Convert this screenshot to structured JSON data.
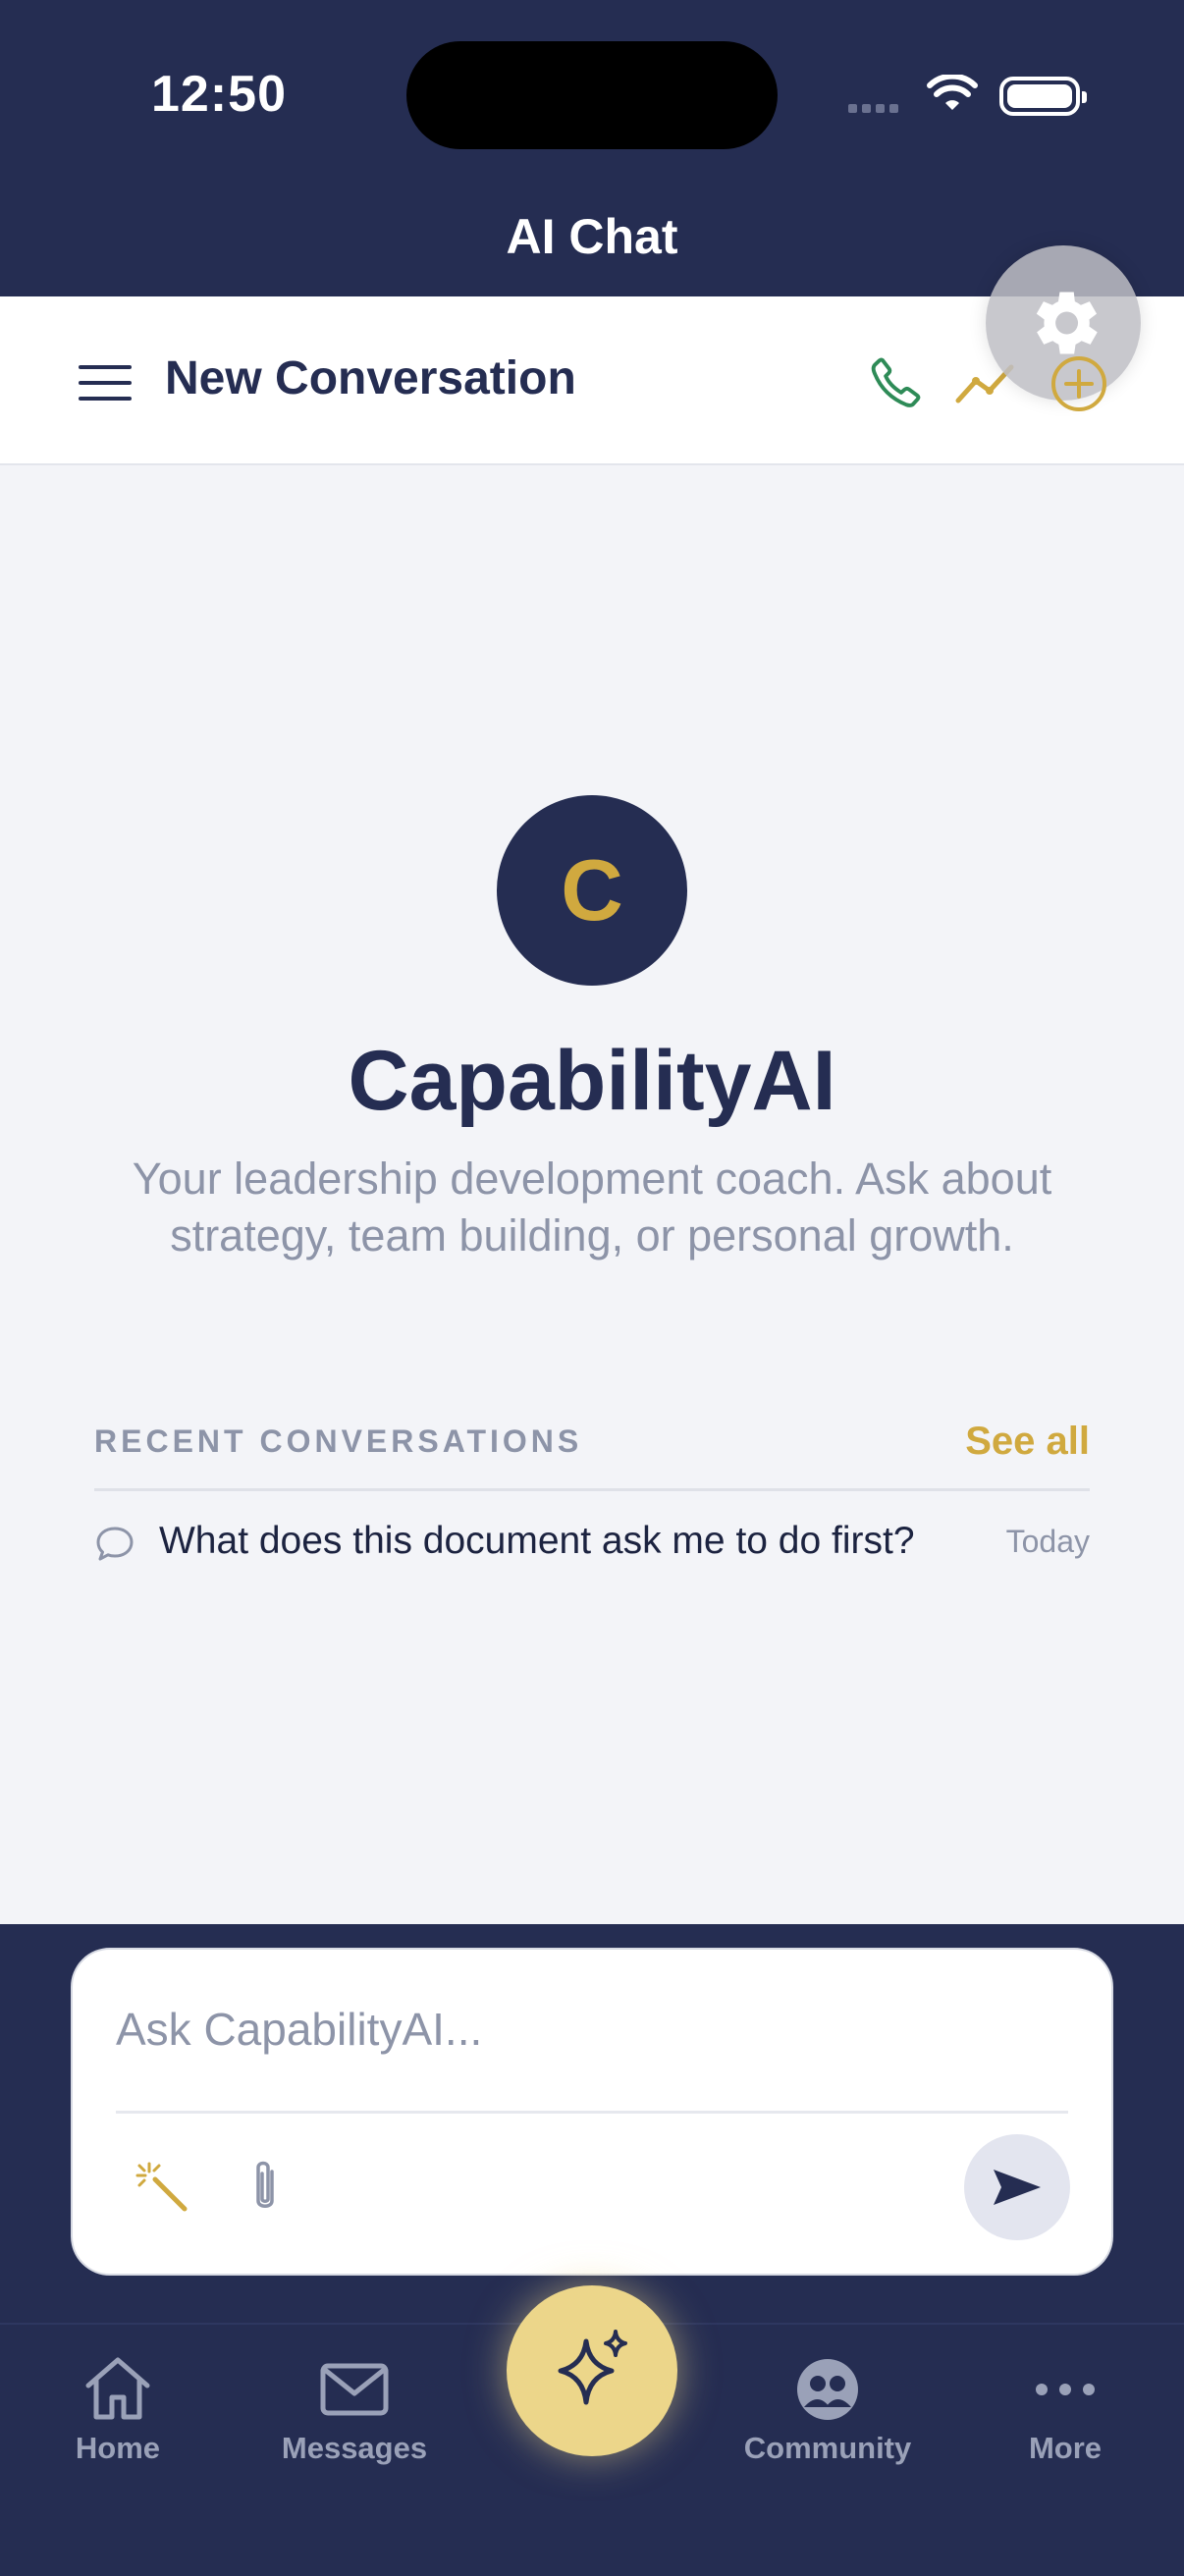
{
  "status": {
    "time": "12:50"
  },
  "header": {
    "title": "AI Chat"
  },
  "conversation": {
    "title": "New Conversation"
  },
  "assistant": {
    "avatar_letter": "C",
    "name": "CapabilityAI",
    "tagline": "Your leadership development coach. Ask about strategy, team building, or personal growth."
  },
  "recent": {
    "label": "RECENT CONVERSATIONS",
    "see_all": "See all",
    "items": [
      {
        "text": "What does this document ask me to do first?",
        "date": "Today"
      }
    ]
  },
  "composer": {
    "placeholder": "Ask CapabilityAI..."
  },
  "tabs": [
    {
      "label": "Home",
      "icon": "home-icon"
    },
    {
      "label": "Messages",
      "icon": "mail-icon"
    },
    {
      "label": "",
      "icon": "sparkles-icon"
    },
    {
      "label": "Community",
      "icon": "community-icon"
    },
    {
      "label": "More",
      "icon": "more-icon"
    }
  ],
  "colors": {
    "navy": "#252d52",
    "gold": "#d0a93f",
    "gold_light": "#ecd68a",
    "green": "#2e8b57",
    "muted": "#8d94a8",
    "background": "#f3f4f8"
  },
  "icons": {
    "menu": "hamburger-icon",
    "call": "phone-icon",
    "insights": "trend-line-icon",
    "new": "plus-circle-icon",
    "settings": "gear-icon",
    "chat": "chat-bubble-icon",
    "magic": "magic-wand-icon",
    "attach": "paperclip-icon",
    "send": "send-icon"
  }
}
